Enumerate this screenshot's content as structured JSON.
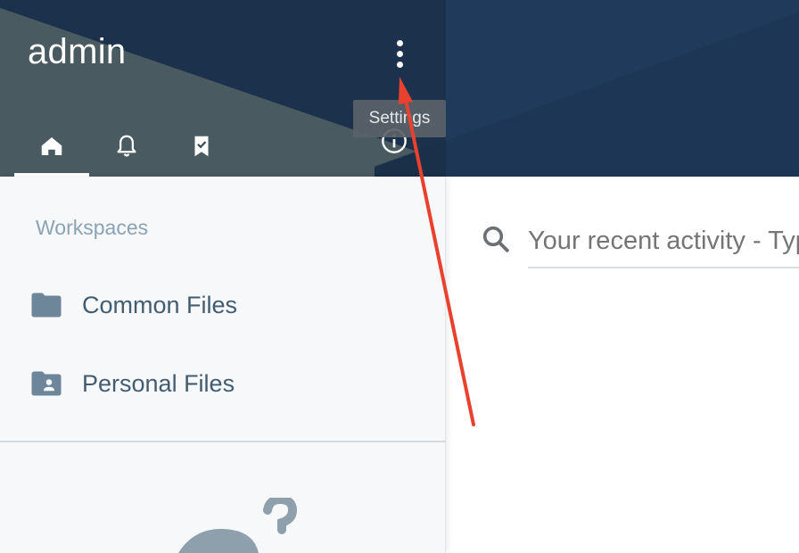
{
  "header": {
    "title": "admin",
    "more_icon": "more-vertical-icon",
    "tooltip": "Settings"
  },
  "tabs": [
    {
      "icon": "home-icon",
      "active": true
    },
    {
      "icon": "bell-icon",
      "active": false
    },
    {
      "icon": "bookmark-check-icon",
      "active": false
    }
  ],
  "info_icon": "info-icon",
  "sidebar": {
    "section_title": "Workspaces",
    "items": [
      {
        "label": "Common Files",
        "icon": "folder-icon"
      },
      {
        "label": "Personal Files",
        "icon": "folder-user-icon"
      }
    ]
  },
  "search": {
    "icon": "search-icon",
    "placeholder": "Your recent activity - Type to search"
  },
  "colors": {
    "banner": "#1f3a5a",
    "sidebar_bg": "#f6f8fa",
    "section_title": "#8aa3b4",
    "item_text": "#425c70",
    "arrow": "#e8422f"
  }
}
